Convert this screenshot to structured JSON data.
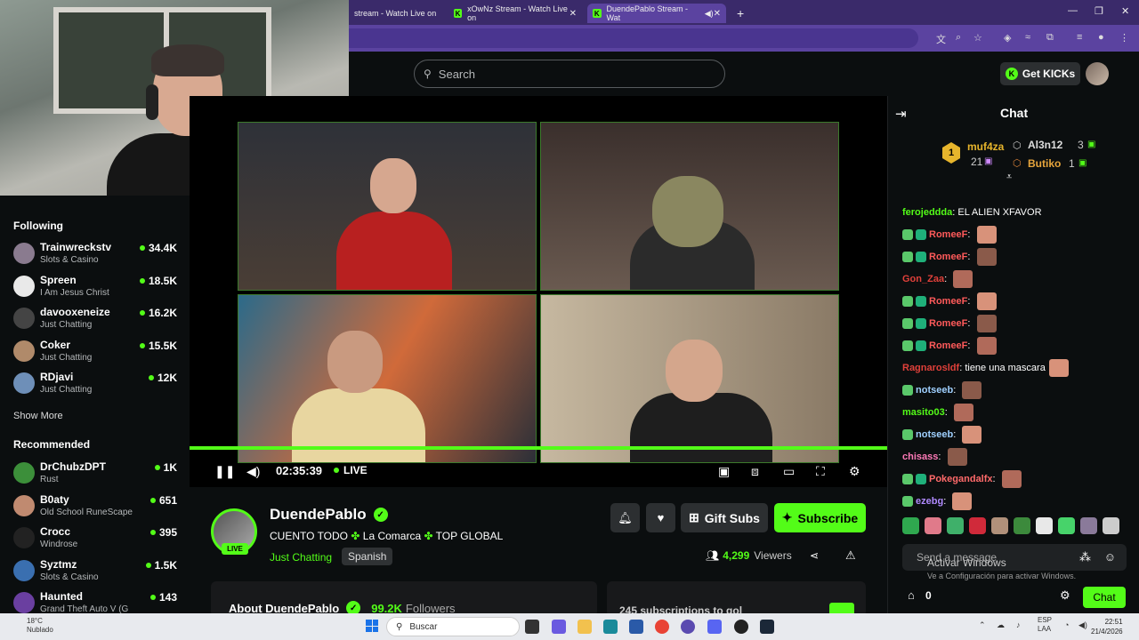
{
  "browser": {
    "tabs": [
      {
        "label": "stream - Watch Live on"
      },
      {
        "label": "xOwNz Stream - Watch Live on"
      },
      {
        "label": "DuendePablo Stream - Wat"
      }
    ],
    "new_tab": "+"
  },
  "nav": {
    "search_placeholder": "Search",
    "get_kicks": "Get KICKs"
  },
  "sidebar": {
    "following_title": "Following",
    "following": [
      {
        "name": "Trainwreckstv",
        "category": "Slots & Casino",
        "viewers": "34.4K",
        "color": "#8a7b8f"
      },
      {
        "name": "Spreen",
        "category": "I Am Jesus Christ",
        "viewers": "18.5K",
        "color": "#e9e9e9"
      },
      {
        "name": "davooxeneize",
        "category": "Just Chatting",
        "viewers": "16.2K",
        "color": "#444"
      },
      {
        "name": "Coker",
        "category": "Just Chatting",
        "viewers": "15.5K",
        "color": "#b08a6a"
      },
      {
        "name": "RDjavi",
        "category": "Just Chatting",
        "viewers": "12K",
        "color": "#6e8fb8"
      }
    ],
    "show_more": "Show More",
    "recommended_title": "Recommended",
    "recommended": [
      {
        "name": "DrChubzDPT",
        "category": "Rust",
        "viewers": "1K",
        "color": "#3c8f3a"
      },
      {
        "name": "B0aty",
        "category": "Old School RuneScape",
        "viewers": "651",
        "color": "#c08a70"
      },
      {
        "name": "Crocc",
        "category": "Windrose",
        "viewers": "395",
        "color": "#222"
      },
      {
        "name": "Syztmz",
        "category": "Slots & Casino",
        "viewers": "1.5K",
        "color": "#3a6fb0"
      },
      {
        "name": "Haunted",
        "category": "Grand Theft Auto V (G",
        "viewers": "143",
        "color": "#6a3fa0"
      }
    ]
  },
  "player": {
    "time": "02:35:39",
    "live": "LIVE"
  },
  "stream": {
    "streamer": "DuendePablo",
    "live_badge": "LIVE",
    "title_parts": [
      "CUENTO TODO",
      "La Comarca",
      "TOP GLOBAL"
    ],
    "category": "Just Chatting",
    "language": "Spanish",
    "gift_subs": "Gift Subs",
    "subscribe": "Subscribe",
    "viewers": "4,299",
    "viewers_label": "Viewers",
    "about": "About DuendePablo",
    "followers": "99.2K",
    "followers_label": "Followers",
    "subs_teaser": "245 subscriptions to gol"
  },
  "chat": {
    "title": "Chat",
    "leaderboard": [
      {
        "name": "muf4za",
        "count": "21"
      },
      {
        "name": "Al3n12",
        "count": "3"
      },
      {
        "name": "Butiko",
        "count": "1"
      }
    ],
    "messages": [
      {
        "user": "ferojeddda",
        "color": "#53fc18",
        "text": "EL ALIEN XFAVOR",
        "badges": 0,
        "emotes": 0
      },
      {
        "user": "RomeeF",
        "color": "#ff5a5a",
        "text": "",
        "badges": 2,
        "emotes": 1
      },
      {
        "user": "RomeeF",
        "color": "#ff5a5a",
        "text": "",
        "badges": 2,
        "emotes": 1
      },
      {
        "user": "Gon_Zaa",
        "color": "#e0403a",
        "text": "",
        "badges": 0,
        "emotes": 1
      },
      {
        "user": "RomeeF",
        "color": "#ff5a5a",
        "text": "",
        "badges": 2,
        "emotes": 1
      },
      {
        "user": "RomeeF",
        "color": "#ff5a5a",
        "text": "",
        "badges": 2,
        "emotes": 1
      },
      {
        "user": "RomeeF",
        "color": "#ff5a5a",
        "text": "",
        "badges": 2,
        "emotes": 1
      },
      {
        "user": "Ragnarosldf",
        "color": "#e0403a",
        "text": "tiene una mascara",
        "badges": 0,
        "emotes": 1
      },
      {
        "user": "notseeb",
        "color": "#9fd0ff",
        "text": "",
        "badges": 1,
        "emotes": 1
      },
      {
        "user": "masito03",
        "color": "#53fc18",
        "text": "",
        "badges": 0,
        "emotes": 1
      },
      {
        "user": "notseeb",
        "color": "#9fd0ff",
        "text": "",
        "badges": 1,
        "emotes": 1
      },
      {
        "user": "chisass",
        "color": "#ff7ab8",
        "text": "",
        "badges": 0,
        "emotes": 1
      },
      {
        "user": "Pokegandalfx",
        "color": "#ff6a6a",
        "text": "",
        "badges": 2,
        "emotes": 1
      },
      {
        "user": "ezebg",
        "color": "#b08aff",
        "text": "",
        "badges": 1,
        "emotes": 1
      }
    ],
    "send_placeholder": "Send a message",
    "activate_title": "Activar Windows",
    "activate_sub": "Ve a Configuración para activar Windows.",
    "store_count": "0",
    "chat_button": "Chat"
  },
  "taskbar": {
    "weather_temp": "18°C",
    "weather_desc": "Nublado",
    "search": "Buscar",
    "lang": "ESP",
    "layout": "LAA",
    "time": "22:51",
    "date": "21/4/2026"
  }
}
